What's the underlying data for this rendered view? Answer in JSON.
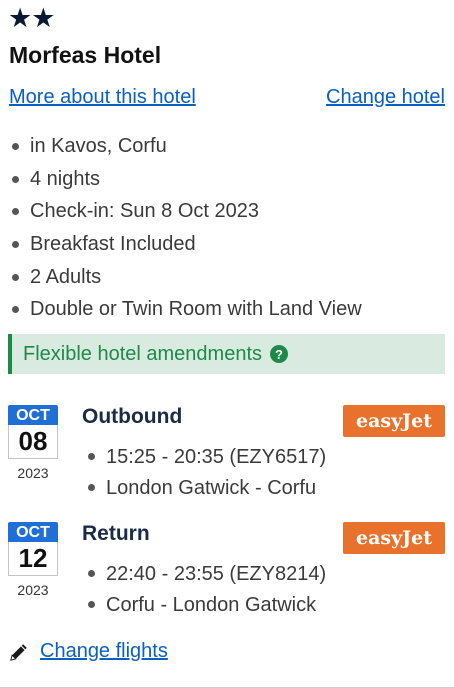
{
  "hotel": {
    "stars": "★★",
    "name": "Morfeas Hotel",
    "more_link": "More about this hotel",
    "change_link": "Change hotel",
    "details": [
      "in Kavos, Corfu",
      "4 nights",
      "Check-in: Sun 8 Oct 2023",
      "Breakfast Included",
      "2 Adults",
      "Double or Twin Room with Land View"
    ],
    "flexible_label": "Flexible hotel amendments",
    "help_icon": "?"
  },
  "flights": [
    {
      "month": "OCT",
      "day": "08",
      "year": "2023",
      "title": "Outbound",
      "airline": "easyJet",
      "lines": [
        "15:25 - 20:35 (EZY6517)",
        "London Gatwick - Corfu"
      ]
    },
    {
      "month": "OCT",
      "day": "12",
      "year": "2023",
      "title": "Return",
      "airline": "easyJet",
      "lines": [
        "22:40 - 23:55 (EZY8214)",
        "Corfu - London Gatwick"
      ]
    }
  ],
  "change_flights": "Change flights",
  "colors": {
    "link": "#0a5fc2",
    "accent_green": "#1d8a48",
    "banner_bg": "#d9ebe0",
    "calendar_blue": "#1f6fd6",
    "easyjet_orange": "#e8722b"
  },
  "icons": {
    "help": "help-icon",
    "edit": "pencil-icon",
    "star": "star-icon"
  }
}
